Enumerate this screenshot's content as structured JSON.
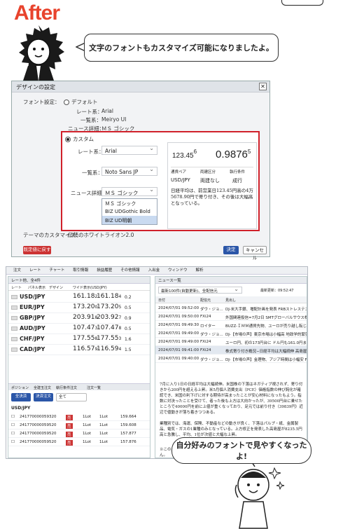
{
  "header": {
    "title": "After"
  },
  "speech_top": "文字のフォントもカスタマイズ可能になりましたよ。",
  "speech_bottom": "自分好みのフォントで見やすくなったよ!",
  "dialog": {
    "title": "デザインの設定",
    "font_setting_label": "フォント設定：",
    "default_option": "デフォルト",
    "default_rows": [
      {
        "label": "レート系：",
        "value": "Arial"
      },
      {
        "label": "一覧系：",
        "value": "Meiryo UI"
      },
      {
        "label": "ニュース詳細：",
        "value": "ＭＳ ゴシック"
      }
    ],
    "custom_option": "カスタム",
    "custom_rows": [
      {
        "label": "レート系：",
        "value": "Arial"
      },
      {
        "label": "一覧系：",
        "value": "Noto Sans JP"
      },
      {
        "label": "ニュース詳細：",
        "value": "ＭＳ ゴシック"
      }
    ],
    "dropdown_options": [
      "ＭＳ ゴシック",
      "BIZ UDGothic Bold",
      "BIZ UD明朝"
    ],
    "preview": {
      "bid_main": "123.45",
      "bid_sup": "6",
      "ask_main": "0.9876",
      "ask_sup": "5",
      "table_headers": [
        "通貨ペア",
        "両建区分",
        "執行条件"
      ],
      "table_values": [
        "USD/JPY",
        "両建なし",
        "成行"
      ],
      "news_text": "日経平均は、前営業日123.45円高の4万5678.90円で寄り付き、その後は大幅高となっている。"
    },
    "theme_label": "テーマのカスタマイズ：",
    "theme_value": "伝統のホワイトライオン2.0",
    "restore_button": "既定値に戻す",
    "ok_button": "決定",
    "cancel_button": "キャンセル"
  },
  "app": {
    "menu": [
      "注文",
      "レート",
      "チャート",
      "取引情報",
      "損益履歴",
      "その他情報",
      "入出金",
      "ウィンドウ",
      "解析"
    ],
    "rate_panel_title": "レート他、全4件",
    "rate_tabs": [
      "レート",
      "パネル表示",
      "デザイン"
    ],
    "rate_option": "ワイド表示(USD/JPY)",
    "rates": [
      {
        "pair": "USD/JPY",
        "bid": "161.18",
        "bid_sup": "2",
        "ask": "161.18",
        "ask_sup": "4",
        "spread": "0.2"
      },
      {
        "pair": "EUR/JPY",
        "bid": "173.20",
        "bid_sup": "0",
        "ask": "173.20",
        "ask_sup": "5",
        "spread": "0.5"
      },
      {
        "pair": "GBP/JPY",
        "bid": "203.91",
        "bid_sup": "8",
        "ask": "203.92",
        "ask_sup": "7",
        "spread": "0.9"
      },
      {
        "pair": "AUD/JPY",
        "bid": "107.47",
        "bid_sup": "3",
        "ask": "107.47",
        "ask_sup": "8",
        "spread": "0.5"
      },
      {
        "pair": "CHF/JPY",
        "bid": "177.55",
        "bid_sup": "8",
        "ask": "177.55",
        "ask_sup": "3",
        "spread": "1.6"
      },
      {
        "pair": "CAD/JPY",
        "bid": "116.57",
        "bid_sup": "9",
        "ask": "116.59",
        "ask_sup": "4",
        "spread": "1.5"
      }
    ],
    "lot_label": "Lot数",
    "position_tabs": [
      "ポジション",
      "全建玉注文",
      "執行条件注文"
    ],
    "order_tab": "注文一覧",
    "settle_all": "全決済",
    "settle_order": "決済注文",
    "filter_all": "全て",
    "position_group": "USD/JPY",
    "positions": [
      {
        "id": "241770000059320",
        "side": "売",
        "lot": "1Lot",
        "lot2": "1Lot",
        "price": "159.664"
      },
      {
        "id": "241770000059520",
        "side": "売",
        "lot": "1Lot",
        "lot2": "1Lot",
        "price": "159.608"
      },
      {
        "id": "241770000059520",
        "side": "売",
        "lot": "1Lot",
        "lot2": "1Lot",
        "price": "157.877"
      },
      {
        "id": "241770000059520",
        "side": "売",
        "lot": "1Lot",
        "lot2": "1Lot",
        "price": "157.876"
      }
    ],
    "news_panel_title": "ニュース一覧",
    "news_filter": "最新100件(自動更新)、全配信元",
    "news_updated": "最新更新：09:52:47",
    "news_headers": [
      "日付",
      "配信元",
      "見出し"
    ],
    "news": [
      {
        "date": "2024/07/01 09:52:00",
        "src": "ダウ・ジョ...",
        "title": "DJ-米大手銀、増配計画を発表 FRBストレステスト合格で"
      },
      {
        "date": "2024/07/01 09:50:00",
        "src": "FXi24",
        "title": "外国関連投信=7月2日 SMTグローバルサウス株式インデックス"
      },
      {
        "date": "2024/07/01 09:49:30",
        "src": "ロイター",
        "title": "BUZZ-ＩＭＭ通貨先物、ユーロが売り越し転じる 円は売り越"
      },
      {
        "date": "2024/07/01 09:49:00",
        "src": "ダウ・ジョ...",
        "title": "DJ-【市場の声】東京市場は小幅高 地政学的緊張で"
      },
      {
        "date": "2024/07/01 09:49:00",
        "src": "FXi24",
        "title": "ユーロ円、初の173円台に ドル円も161.0円まで強含み"
      },
      {
        "date": "2024/07/01 09:41:00",
        "src": "FXi24",
        "title": "株式寄り付き概況−日経平均は大幅続伸 高島屋が急騰"
      },
      {
        "date": "2024/07/01 09:40:00",
        "src": "ダウ・ジョ...",
        "title": "DJ-【市場の声】金理物、アジア時間は小幅安 FRBの政策運営に"
      }
    ],
    "news_body": "7月に入り1日の日経平均は大幅続伸。米国株の下落はネガティブ視されず、寄り付きから200円を超える上昇。米5月個人消費支出（PCE）価格指数の伸び鈍化が確認でき、米国の利下げに対する期待が高まったことが安心材料になったもよう。指数に対決ったことを受けて、者った後も上方は大向かったが、39500円台に乗せたところで40000円を前に上値が重くなっており、足元では前り付き（39839円）近辺で値動きが落ち着きつつある。\n\n業種別では、海運、保険、不動産などの動きが良く、下落はパルプ・紙、金属製品、電気・ガスの1業種のみとなっている。上方修正を発表した高島屋が8235.5円高と急騰し、平均、1位が次値と大幅な上昇。",
    "news_footer": "※このレポートは情報提供を目的とし、投資の勧誘を目的とするものではありません。"
  }
}
